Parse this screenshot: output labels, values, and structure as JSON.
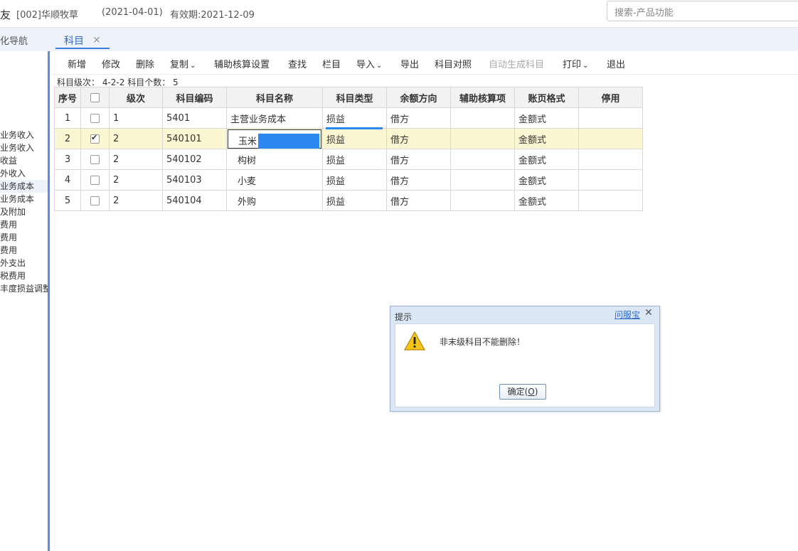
{
  "header": {
    "logo_fragment": "友",
    "company": "[002]华顺牧草",
    "period": "(2021-04-01)",
    "validity": "有效期:2021-12-09",
    "search_placeholder": "搜索-产品功能"
  },
  "tabs": {
    "nav_tab_label": "化导航",
    "active_tab_label": "科目",
    "close_glyph": "✕"
  },
  "sidebar": {
    "items": [
      {
        "label": "业务收入"
      },
      {
        "label": "业务收入"
      },
      {
        "label": "收益"
      },
      {
        "label": "外收入"
      },
      {
        "label": "业务成本",
        "active": true
      },
      {
        "label": "业务成本"
      },
      {
        "label": "及附加"
      },
      {
        "label": "费用"
      },
      {
        "label": "费用"
      },
      {
        "label": "费用"
      },
      {
        "label": "外支出"
      },
      {
        "label": "税费用"
      },
      {
        "label": "丰度损益调整"
      }
    ]
  },
  "toolbar": {
    "add": "新增",
    "edit": "修改",
    "delete": "删除",
    "copy": "复制",
    "aux_settings": "辅助核算设置",
    "find": "查找",
    "columns": "栏目",
    "import": "导入",
    "export": "导出",
    "mapping": "科目对照",
    "auto_generate": "自动生成科目",
    "print": "打印",
    "exit": "退出",
    "caret": "⌄"
  },
  "info": {
    "text": "科目级次： 4-2-2   科目个数： 5"
  },
  "table": {
    "headers": [
      "序号",
      "",
      "级次",
      "科目编码",
      "科目名称",
      "科目类型",
      "余额方向",
      "辅助核算项",
      "账页格式",
      "停用"
    ],
    "rows": [
      {
        "seq": "1",
        "checked": false,
        "level": "1",
        "code": "5401",
        "name": "主营业务成本",
        "type": "损益",
        "direction": "借方",
        "aux": "",
        "format": "金额式",
        "disabled": ""
      },
      {
        "seq": "2",
        "checked": true,
        "level": "2",
        "code": "540101",
        "name": "玉米",
        "type": "损益",
        "direction": "借方",
        "aux": "",
        "format": "金额式",
        "disabled": ""
      },
      {
        "seq": "3",
        "checked": false,
        "level": "2",
        "code": "540102",
        "name": "构树",
        "type": "损益",
        "direction": "借方",
        "aux": "",
        "format": "金额式",
        "disabled": ""
      },
      {
        "seq": "4",
        "checked": false,
        "level": "2",
        "code": "540103",
        "name": "小麦",
        "type": "损益",
        "direction": "借方",
        "aux": "",
        "format": "金额式",
        "disabled": ""
      },
      {
        "seq": "5",
        "checked": false,
        "level": "2",
        "code": "540104",
        "name": "外购",
        "type": "损益",
        "direction": "借方",
        "aux": "",
        "format": "金额式",
        "disabled": ""
      }
    ]
  },
  "dialog": {
    "title": "提示",
    "help_link": "问服宝",
    "close_glyph": "✕",
    "message": "非末级科目不能删除！",
    "ok_label": "确定(",
    "ok_key": "O",
    "ok_suffix": ")"
  },
  "colors": {
    "accent": "#2d6bcc",
    "selection": "#2b88f0",
    "selected_row": "#fdf6d2"
  }
}
